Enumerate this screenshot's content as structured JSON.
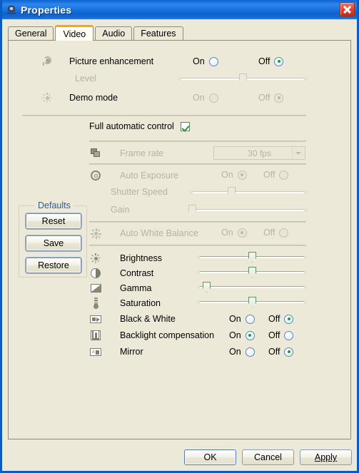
{
  "window": {
    "title": "Properties",
    "icon": "webcam-icon",
    "close_label": "✕"
  },
  "tabs": [
    {
      "label": "General",
      "active": false
    },
    {
      "label": "Video",
      "active": true
    },
    {
      "label": "Audio",
      "active": false
    },
    {
      "label": "Features",
      "active": false
    }
  ],
  "video": {
    "picture_enhancement": {
      "label": "Picture enhancement",
      "icon": "picture-enhancement-icon",
      "on_label": "On",
      "off_label": "Off",
      "value": "Off"
    },
    "level": {
      "label": "Level",
      "enabled": false,
      "position_pct": 50
    },
    "demo_mode": {
      "label": "Demo mode",
      "icon": "sun-icon",
      "on_label": "On",
      "off_label": "Off",
      "value": "Off",
      "enabled": false
    },
    "full_automatic_control": {
      "label": "Full automatic control",
      "checked": true
    },
    "frame_rate": {
      "label": "Frame rate",
      "icon": "frames-icon",
      "value": "30 fps",
      "enabled": false
    },
    "auto_exposure": {
      "label": "Auto Exposure",
      "icon": "exposure-icon",
      "on_label": "On",
      "off_label": "Off",
      "value": "On",
      "enabled": false
    },
    "shutter_speed": {
      "label": "Shutter Speed",
      "enabled": false,
      "position_pct": 35
    },
    "gain": {
      "label": "Gain",
      "enabled": false,
      "position_pct": 1
    },
    "auto_white_balance": {
      "label": "Auto White Balance",
      "icon": "white-balance-icon",
      "on_label": "On",
      "off_label": "Off",
      "value": "On",
      "enabled": false
    },
    "brightness": {
      "label": "Brightness",
      "icon": "sun-icon",
      "position_pct": 50
    },
    "contrast": {
      "label": "Contrast",
      "icon": "contrast-icon",
      "position_pct": 50
    },
    "gamma": {
      "label": "Gamma",
      "icon": "gamma-icon",
      "position_pct": 8
    },
    "saturation": {
      "label": "Saturation",
      "icon": "saturation-icon",
      "position_pct": 50
    },
    "black_and_white": {
      "label": "Black & White",
      "icon": "black-white-icon",
      "on_label": "On",
      "off_label": "Off",
      "value": "Off"
    },
    "backlight_compensation": {
      "label": "Backlight compensation",
      "icon": "backlight-icon",
      "on_label": "On",
      "off_label": "Off",
      "value": "On"
    },
    "mirror": {
      "label": "Mirror",
      "icon": "mirror-icon",
      "on_label": "On",
      "off_label": "Off",
      "value": "Off"
    }
  },
  "defaults": {
    "legend": "Defaults",
    "reset_label": "Reset",
    "save_label": "Save",
    "restore_label": "Restore"
  },
  "footer": {
    "ok_label": "OK",
    "cancel_label": "Cancel",
    "apply_label": "Apply"
  },
  "colors": {
    "titlebar_blue": "#1d77e2",
    "panel_bg": "#ece9d8",
    "active_tab_accent": "#f3a622",
    "radio_dot_green": "#1e9e35",
    "disabled_text": "#b8b3a0",
    "legend_blue": "#2f5d8e"
  }
}
